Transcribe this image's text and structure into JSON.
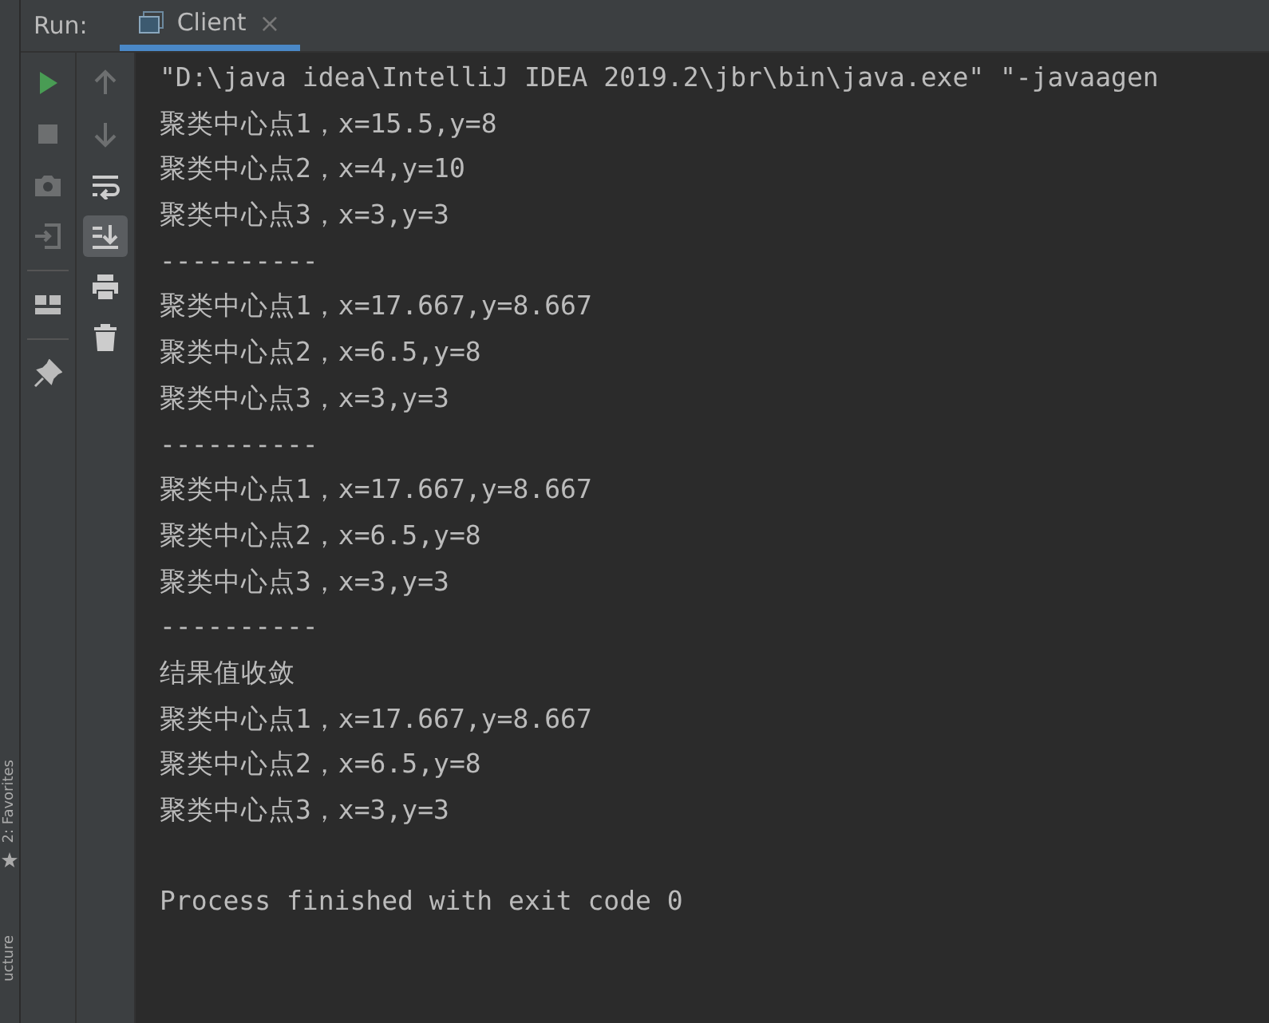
{
  "header": {
    "label": "Run:",
    "tab": {
      "title": "Client",
      "selected": true,
      "close": "×"
    }
  },
  "left_tools": [
    {
      "kind": "run",
      "enabled": true
    },
    {
      "kind": "stop",
      "enabled": false
    },
    {
      "kind": "camera",
      "enabled": false
    },
    {
      "kind": "enter",
      "enabled": false
    },
    {
      "kind": "layout",
      "enabled": true
    },
    {
      "kind": "pin",
      "enabled": true
    }
  ],
  "right_tools": [
    {
      "kind": "up",
      "enabled": false,
      "on": false
    },
    {
      "kind": "down",
      "enabled": false,
      "on": false
    },
    {
      "kind": "wrap",
      "enabled": true,
      "on": false
    },
    {
      "kind": "scroll-end",
      "enabled": true,
      "on": true
    },
    {
      "kind": "print",
      "enabled": true,
      "on": false
    },
    {
      "kind": "trash",
      "enabled": true,
      "on": false
    }
  ],
  "side_strip": {
    "favorites": "2: Favorites",
    "structure": "ucture"
  },
  "console": {
    "lines": [
      "\"D:\\java idea\\IntelliJ IDEA 2019.2\\jbr\\bin\\java.exe\" \"-javaagen",
      "聚类中心点1，x=15.5,y=8",
      "聚类中心点2，x=4,y=10",
      "聚类中心点3，x=3,y=3",
      "----------",
      "聚类中心点1，x=17.667,y=8.667",
      "聚类中心点2，x=6.5,y=8",
      "聚类中心点3，x=3,y=3",
      "----------",
      "聚类中心点1，x=17.667,y=8.667",
      "聚类中心点2，x=6.5,y=8",
      "聚类中心点3，x=3,y=3",
      "----------",
      "结果值收敛",
      "聚类中心点1，x=17.667,y=8.667",
      "聚类中心点2，x=6.5,y=8",
      "聚类中心点3，x=3,y=3"
    ],
    "exit_message": "Process finished with exit code 0"
  }
}
